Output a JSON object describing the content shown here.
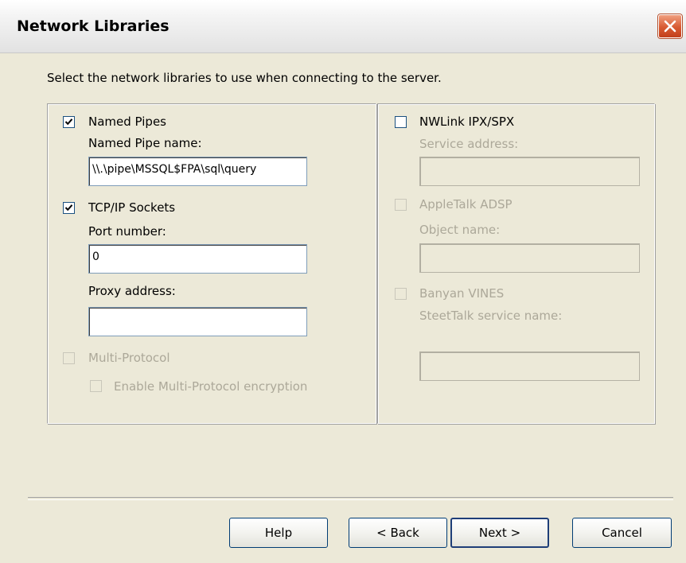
{
  "window": {
    "title": "Network Libraries"
  },
  "instruction": "Select the network libraries to use when connecting to the server.",
  "left_group": {
    "named_pipes": {
      "label": "Named Pipes",
      "checked": true,
      "name_label": "Named Pipe name:",
      "name_value": "\\\\.\\pipe\\MSSQL$FPA\\sql\\query"
    },
    "tcpip": {
      "label": "TCP/IP Sockets",
      "checked": true,
      "port_label": "Port number:",
      "port_value": "0",
      "proxy_label": "Proxy address:",
      "proxy_value": ""
    },
    "multi_protocol": {
      "label": "Multi-Protocol",
      "checked": false,
      "enabled": false,
      "encryption_label": "Enable Multi-Protocol encryption",
      "encryption_checked": false,
      "encryption_enabled": false
    }
  },
  "right_group": {
    "nwlink": {
      "label": "NWLink IPX/SPX",
      "checked": false,
      "service_label": "Service address:",
      "service_value": ""
    },
    "appletalk": {
      "label": "AppleTalk ADSP",
      "checked": false,
      "enabled": false,
      "object_label": "Object name:",
      "object_value": ""
    },
    "banyan": {
      "label": "Banyan VINES",
      "checked": false,
      "enabled": false,
      "streettalk_label": "SteetTalk service name:",
      "streettalk_value": ""
    }
  },
  "buttons": {
    "help": "Help",
    "back": "< Back",
    "next": "Next >",
    "cancel": "Cancel"
  },
  "colors": {
    "dialog_background": "#ece9d8",
    "disabled_text": "#aca899",
    "close_button": "#d85a32",
    "default_button_border": "#1e3e78"
  }
}
